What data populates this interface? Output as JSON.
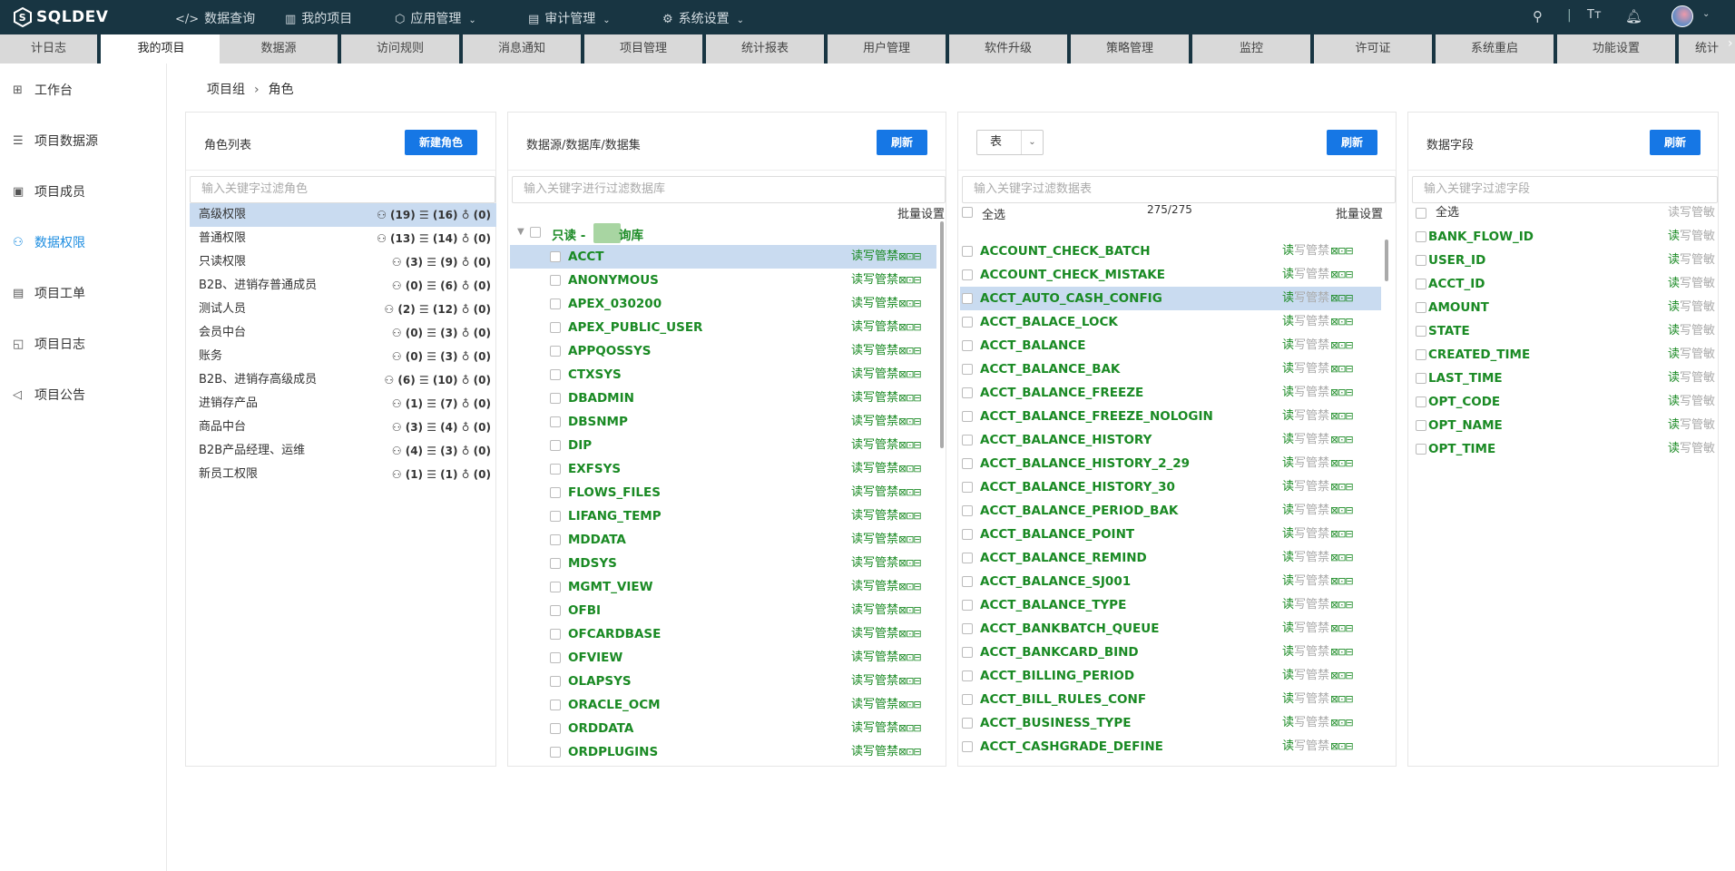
{
  "app": {
    "brand": "SQLDEV"
  },
  "topnav": [
    {
      "label": "数据查询",
      "icon": "code-icon",
      "caret": false
    },
    {
      "label": "我的项目",
      "icon": "notebook-icon",
      "caret": false
    },
    {
      "label": "应用管理",
      "icon": "cube-icon",
      "caret": true
    },
    {
      "label": "审计管理",
      "icon": "audit-icon",
      "caret": true
    },
    {
      "label": "系统设置",
      "icon": "gear-icon",
      "caret": true
    }
  ],
  "tabs": [
    "计日志",
    "我的项目",
    "数据源",
    "访问规则",
    "消息通知",
    "项目管理",
    "统计报表",
    "用户管理",
    "软件升级",
    "策略管理",
    "监控",
    "许可证",
    "系统重启",
    "功能设置",
    "统计"
  ],
  "sidebar": [
    "工作台",
    "项目数据源",
    "项目成员",
    "数据权限",
    "项目工单",
    "项目日志",
    "项目公告"
  ],
  "breadcrumb": {
    "parent": "项目组",
    "current": "角色"
  },
  "roles_panel": {
    "title": "角色列表",
    "button": "新建角色",
    "filter_placeholder": "输入关键字过滤角色",
    "roles": [
      {
        "name": "高级权限",
        "users": "(19)",
        "dbs": "(16)",
        "rules": "(0)"
      },
      {
        "name": "普通权限",
        "users": "(13)",
        "dbs": "(14)",
        "rules": "(0)"
      },
      {
        "name": "只读权限",
        "users": "(3)",
        "dbs": "(9)",
        "rules": "(0)"
      },
      {
        "name": "B2B、进销存普通成员",
        "users": "(0)",
        "dbs": "(6)",
        "rules": "(0)"
      },
      {
        "name": "测试人员",
        "users": "(2)",
        "dbs": "(12)",
        "rules": "(0)"
      },
      {
        "name": "会员中台",
        "users": "(0)",
        "dbs": "(3)",
        "rules": "(0)"
      },
      {
        "name": "账务",
        "users": "(0)",
        "dbs": "(3)",
        "rules": "(0)"
      },
      {
        "name": "B2B、进销存高级成员",
        "users": "(6)",
        "dbs": "(10)",
        "rules": "(0)"
      },
      {
        "name": "进销存产品",
        "users": "(1)",
        "dbs": "(7)",
        "rules": "(0)"
      },
      {
        "name": "商品中台",
        "users": "(3)",
        "dbs": "(4)",
        "rules": "(0)"
      },
      {
        "name": "B2B产品经理、运维",
        "users": "(4)",
        "dbs": "(3)",
        "rules": "(0)"
      },
      {
        "name": "新员工权限",
        "users": "(1)",
        "dbs": "(1)",
        "rules": "(0)"
      }
    ]
  },
  "ds_panel": {
    "title": "数据源/数据库/数据集",
    "button": "刷新",
    "filter_placeholder": "输入关键字进行过滤数据库",
    "batch": "批量设置",
    "group_prefix": "只读 -",
    "group_suffix": "询库",
    "perm_read": "读",
    "perm_write": "写",
    "perm_manage": "管",
    "perm_forbid": "禁",
    "items": [
      "ACCT",
      "ANONYMOUS",
      "APEX_030200",
      "APEX_PUBLIC_USER",
      "APPQOSSYS",
      "CTXSYS",
      "DBADMIN",
      "DBSNMP",
      "DIP",
      "EXFSYS",
      "FLOWS_FILES",
      "LIFANG_TEMP",
      "MDDATA",
      "MDSYS",
      "MGMT_VIEW",
      "OFBI",
      "OFCARDBASE",
      "OFVIEW",
      "OLAPSYS",
      "ORACLE_OCM",
      "ORDDATA",
      "ORDPLUGINS"
    ]
  },
  "table_panel": {
    "type_select": "表",
    "button": "刷新",
    "filter_placeholder": "输入关键字过滤数据表",
    "select_all": "全选",
    "count": "275/275",
    "batch": "批量设置",
    "items": [
      "ACCOUNT_CHECK_BATCH",
      "ACCOUNT_CHECK_MISTAKE",
      "ACCT_AUTO_CASH_CONFIG",
      "ACCT_BALACE_LOCK",
      "ACCT_BALANCE",
      "ACCT_BALANCE_BAK",
      "ACCT_BALANCE_FREEZE",
      "ACCT_BALANCE_FREEZE_NOLOGIN",
      "ACCT_BALANCE_HISTORY",
      "ACCT_BALANCE_HISTORY_2_29",
      "ACCT_BALANCE_HISTORY_30",
      "ACCT_BALANCE_PERIOD_BAK",
      "ACCT_BALANCE_POINT",
      "ACCT_BALANCE_REMIND",
      "ACCT_BALANCE_SJ001",
      "ACCT_BALANCE_TYPE",
      "ACCT_BANKBATCH_QUEUE",
      "ACCT_BANKCARD_BIND",
      "ACCT_BILLING_PERIOD",
      "ACCT_BILL_RULES_CONF",
      "ACCT_BUSINESS_TYPE",
      "ACCT_CASHGRADE_DEFINE"
    ]
  },
  "field_panel": {
    "title": "数据字段",
    "button": "刷新",
    "filter_placeholder": "输入关键字过滤字段",
    "select_all": "全选",
    "header_perm": "读写管敏",
    "perm_r": "读",
    "perm_rest": "写管敏",
    "items": [
      "BANK_FLOW_ID",
      "USER_ID",
      "ACCT_ID",
      "AMOUNT",
      "STATE",
      "CREATED_TIME",
      "LAST_TIME",
      "OPT_CODE",
      "OPT_NAME",
      "OPT_TIME"
    ]
  },
  "colors": {
    "topbar": "#183542",
    "accent": "#1677e5",
    "green": "#1a8a24",
    "selected": "#c9dbf0"
  }
}
